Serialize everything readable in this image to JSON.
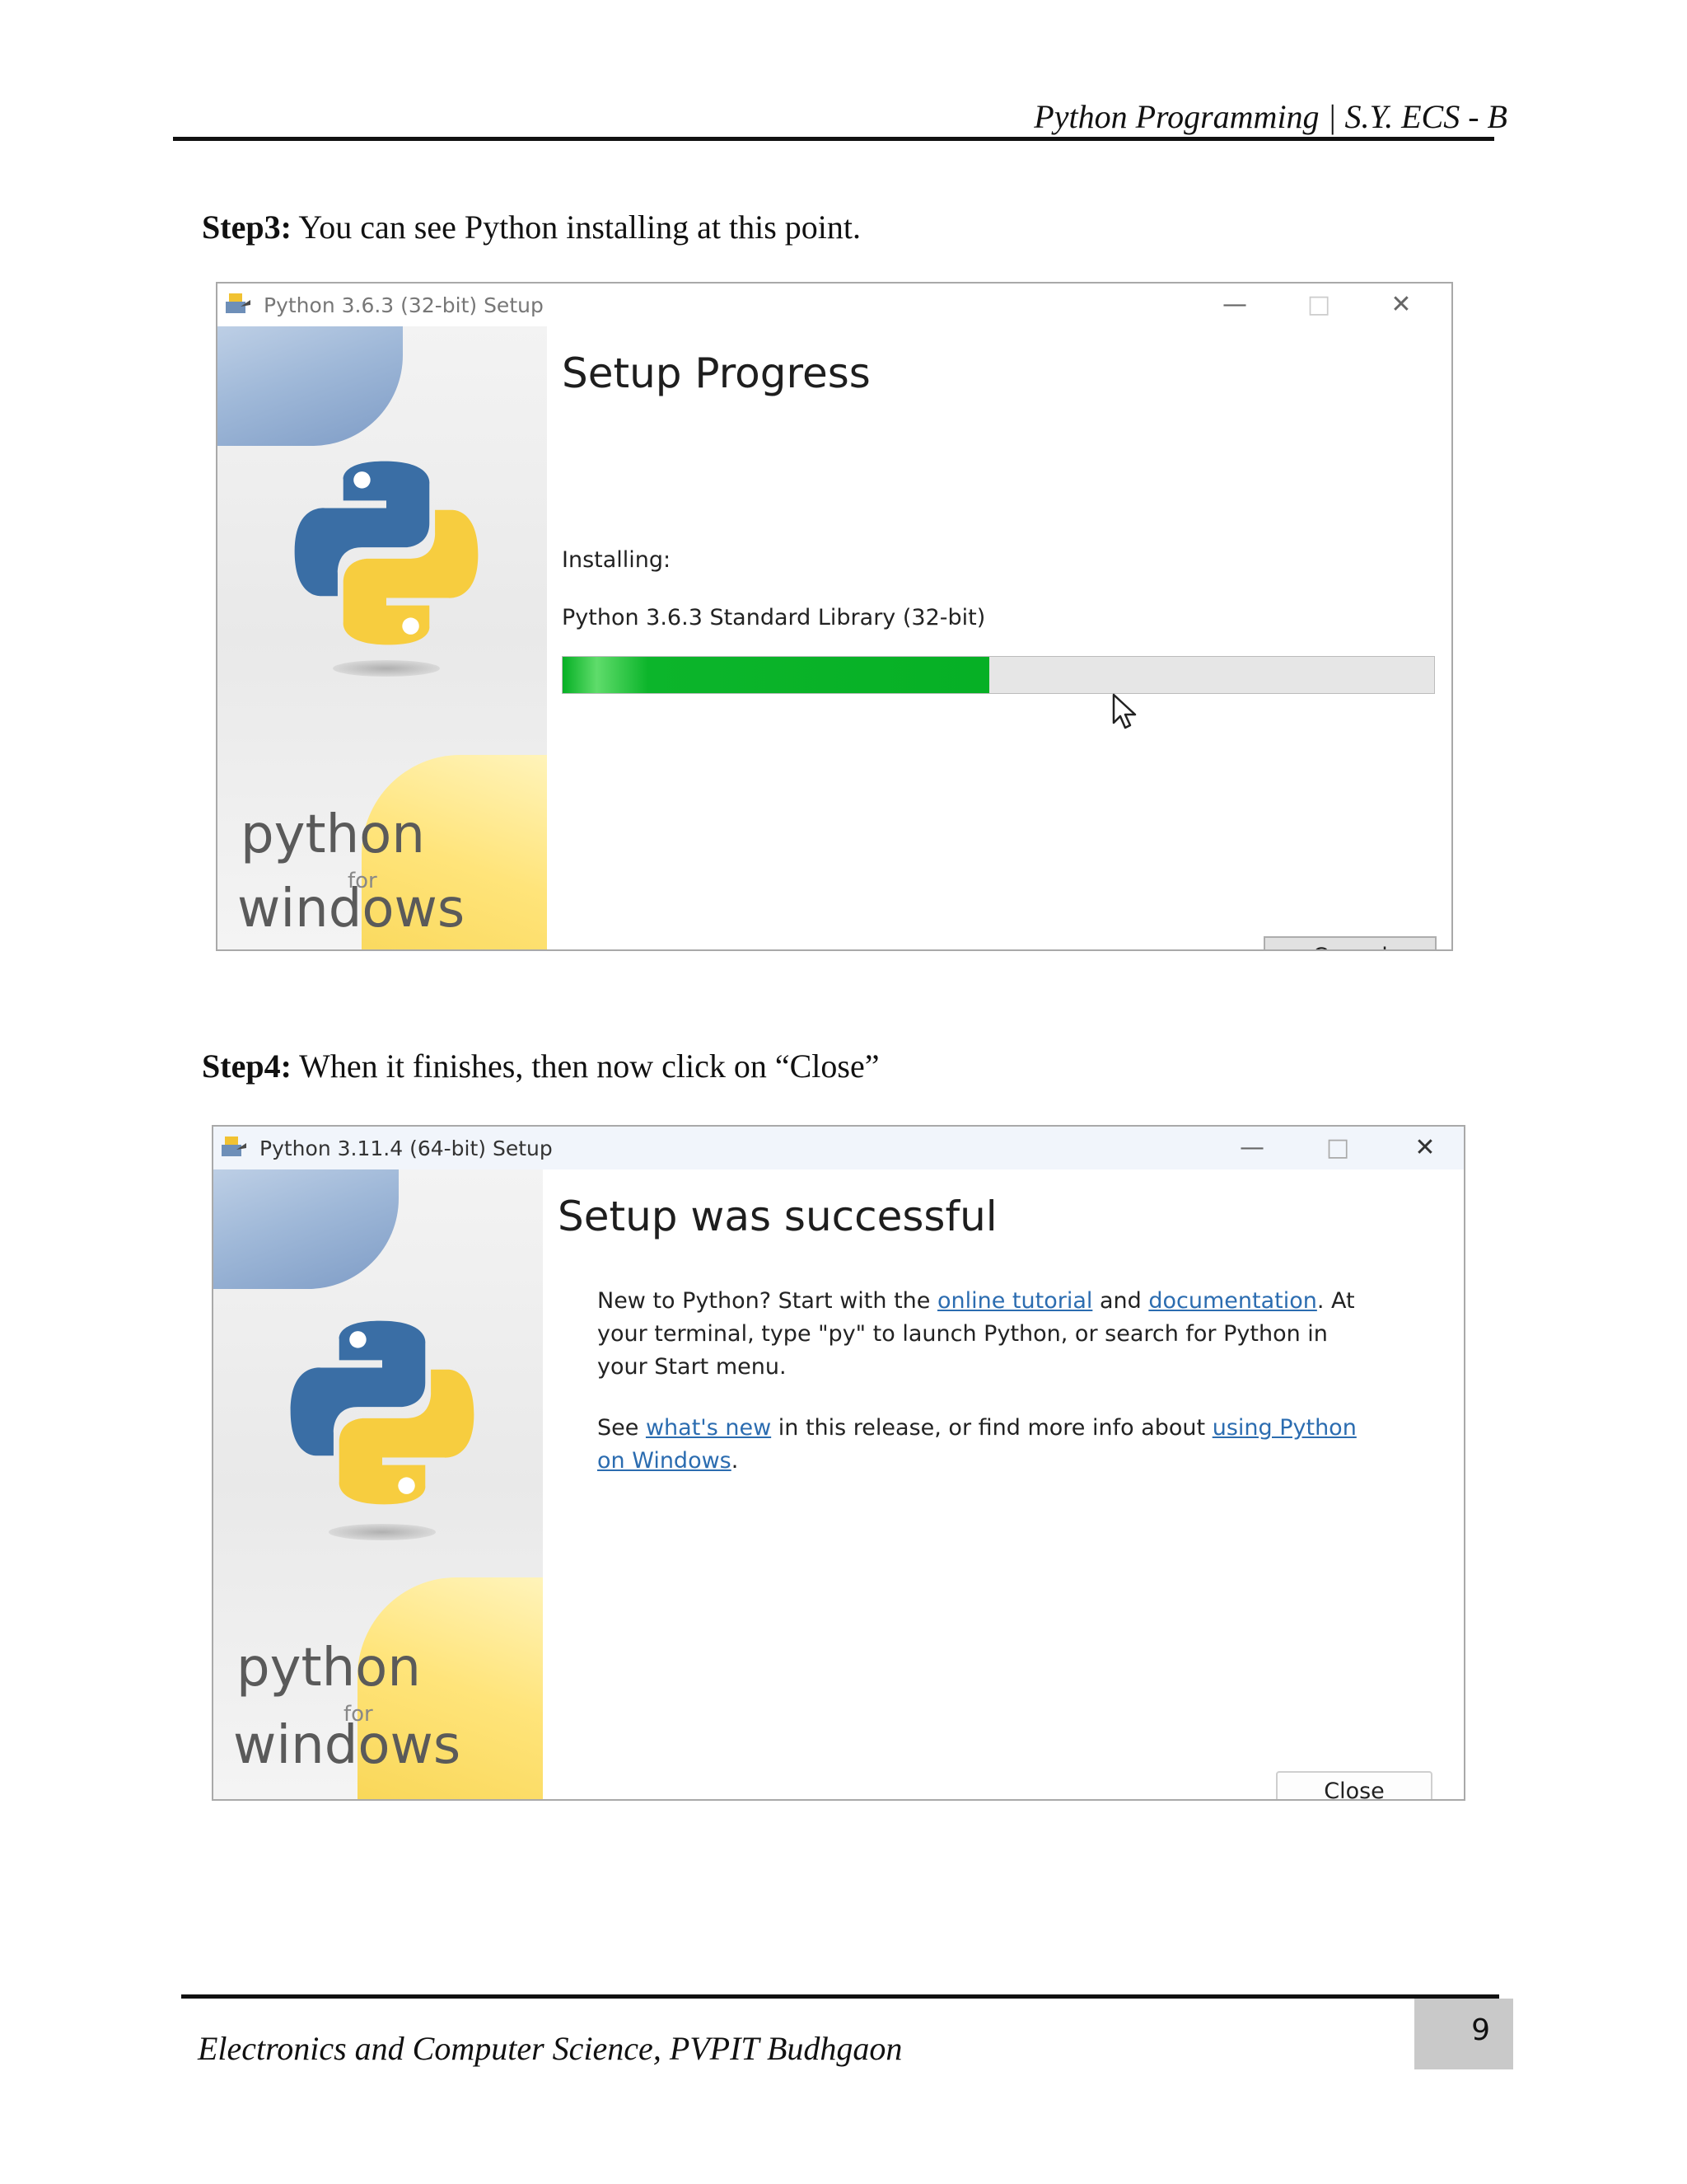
{
  "header": {
    "text": "Python Programming | S.Y. ECS - B"
  },
  "step3": {
    "label": "Step3:",
    "text": " You can see Python installing at this point.",
    "window": {
      "title": "Python 3.6.3 (32-bit) Setup",
      "heading": "Setup Progress",
      "status_label": "Installing:",
      "current_item": "Python 3.6.3 Standard Library (32-bit)",
      "progress_fraction": 0.49,
      "cancel_label": "Cancel",
      "side_python": "python",
      "side_for": "for",
      "side_windows": "windows"
    }
  },
  "step4": {
    "label": "Step4:",
    "text": " When it finishes, then now click on “Close”",
    "window": {
      "title": "Python 3.11.4 (64-bit) Setup",
      "heading": "Setup was successful",
      "para1_a": "New to Python? Start with the ",
      "link_online_tutorial": "online tutorial",
      "para1_b": " and ",
      "link_documentation": "documentation",
      "para1_c": ". At your terminal, type \"py\" to launch Python, or search for Python in your Start menu.",
      "para2_a": "See ",
      "link_whats_new": "what's new",
      "para2_b": " in this release, or find more info about ",
      "link_using_python": "using Python on Windows",
      "para2_c": ".",
      "close_label": "Close",
      "side_python": "python",
      "side_for": "for",
      "side_windows": "windows"
    }
  },
  "footer": {
    "text": "Electronics and Computer Science, PVPIT Budhgaon",
    "page_number": "9"
  },
  "colors": {
    "progress_green": "#06b025",
    "link_blue": "#2b6cb0",
    "python_blue": "#3a6ea5",
    "python_yellow": "#f7cd3f"
  }
}
